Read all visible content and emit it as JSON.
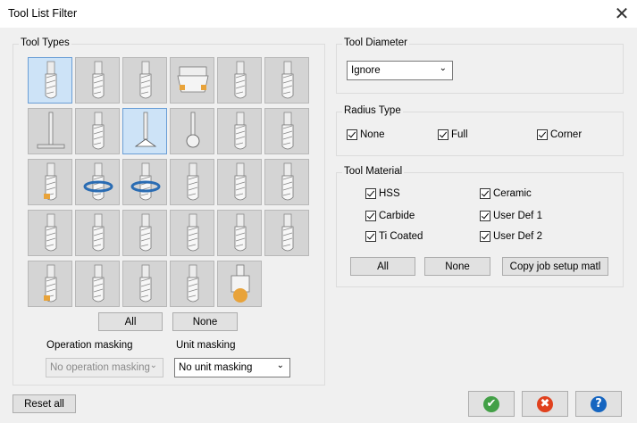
{
  "window": {
    "title": "Tool List Filter",
    "close_glyph": "✕"
  },
  "tool_types": {
    "label": "Tool Types",
    "tiles": [
      {
        "name": "flat-endmill",
        "selected": true
      },
      {
        "name": "ball-endmill",
        "selected": false
      },
      {
        "name": "bull-endmill",
        "selected": false
      },
      {
        "name": "face-mill",
        "selected": false
      },
      {
        "name": "chamfer-mill",
        "selected": false
      },
      {
        "name": "form-mill",
        "selected": false
      },
      {
        "name": "slot-mill",
        "selected": false
      },
      {
        "name": "taper-mill",
        "selected": false
      },
      {
        "name": "dovetail-mill",
        "selected": true
      },
      {
        "name": "lollipop-mill",
        "selected": false
      },
      {
        "name": "drill",
        "selected": false
      },
      {
        "name": "reamer",
        "selected": false
      },
      {
        "name": "boring-bar",
        "selected": false
      },
      {
        "name": "right-hand-tap",
        "selected": false
      },
      {
        "name": "left-hand-tap",
        "selected": false
      },
      {
        "name": "center-drill",
        "selected": false
      },
      {
        "name": "spot-drill",
        "selected": false
      },
      {
        "name": "counterbore",
        "selected": false
      },
      {
        "name": "countersink",
        "selected": false
      },
      {
        "name": "thread-mill",
        "selected": false
      },
      {
        "name": "engrave-tool",
        "selected": false
      },
      {
        "name": "tapered-endmill",
        "selected": false
      },
      {
        "name": "insert-mill",
        "selected": false
      },
      {
        "name": "disc-mill",
        "selected": false
      },
      {
        "name": "undercut-tool",
        "selected": false
      },
      {
        "name": "ball-taper-mill",
        "selected": false
      },
      {
        "name": "barrel-mill",
        "selected": false
      },
      {
        "name": "lens-mill",
        "selected": false
      },
      {
        "name": "radius-drill",
        "selected": false
      }
    ],
    "all_button": "All",
    "none_button": "None"
  },
  "operation_masking": {
    "label": "Operation masking",
    "value": "No operation masking"
  },
  "unit_masking": {
    "label": "Unit masking",
    "value": "No unit masking"
  },
  "tool_diameter": {
    "label": "Tool Diameter",
    "value": "Ignore"
  },
  "radius_type": {
    "label": "Radius Type",
    "options": [
      {
        "label": "None",
        "checked": true
      },
      {
        "label": "Full",
        "checked": true
      },
      {
        "label": "Corner",
        "checked": true
      }
    ]
  },
  "tool_material": {
    "label": "Tool Material",
    "options": [
      {
        "label": "HSS",
        "checked": true
      },
      {
        "label": "Ceramic",
        "checked": true
      },
      {
        "label": "Carbide",
        "checked": true
      },
      {
        "label": "User Def 1",
        "checked": true
      },
      {
        "label": "Ti Coated",
        "checked": true
      },
      {
        "label": "User Def 2",
        "checked": true
      }
    ],
    "all_button": "All",
    "none_button": "None",
    "copy_button": "Copy job setup matl"
  },
  "footer": {
    "reset_button": "Reset all",
    "ok_icon": "green-check-icon",
    "cancel_icon": "red-x-icon",
    "help_icon": "blue-question-icon"
  },
  "colors": {
    "ok": "#43a047",
    "cancel": "#e0411e",
    "help": "#1565c0",
    "selected_tile": "#cde3f7",
    "insert_gold": "#e8a33a"
  }
}
